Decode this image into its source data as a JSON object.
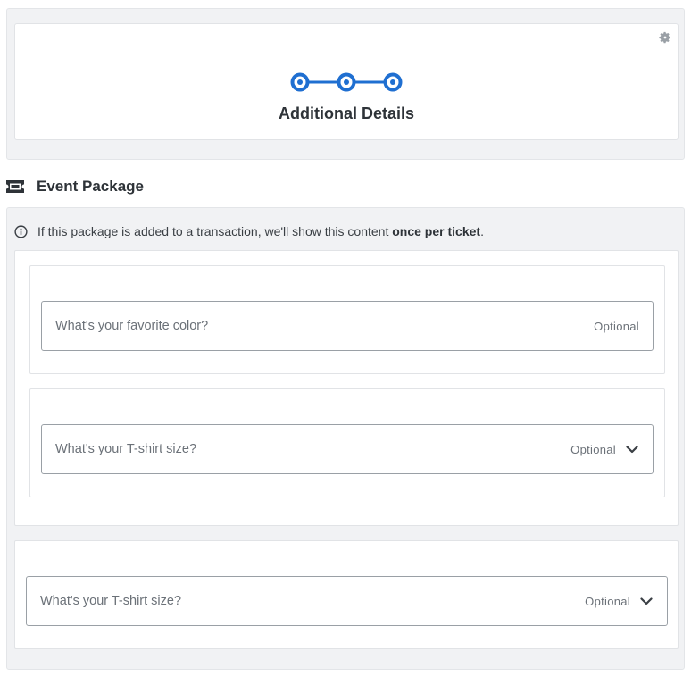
{
  "header": {
    "step_title": "Additional Details",
    "step_count": 3,
    "accent_color": "#1f6fd1"
  },
  "section": {
    "title": "Event Package",
    "icon": "ticket-icon"
  },
  "info": {
    "text_prefix": "If this package is added to a transaction, we'll show this content ",
    "text_bold": "once per ticket",
    "text_suffix": "."
  },
  "questions": [
    {
      "label": "What's your favorite color?",
      "optional": "Optional",
      "type": "text"
    },
    {
      "label": "What's your T-shirt size?",
      "optional": "Optional",
      "type": "select"
    },
    {
      "label": "What's your T-shirt size?",
      "optional": "Optional",
      "type": "select"
    }
  ]
}
